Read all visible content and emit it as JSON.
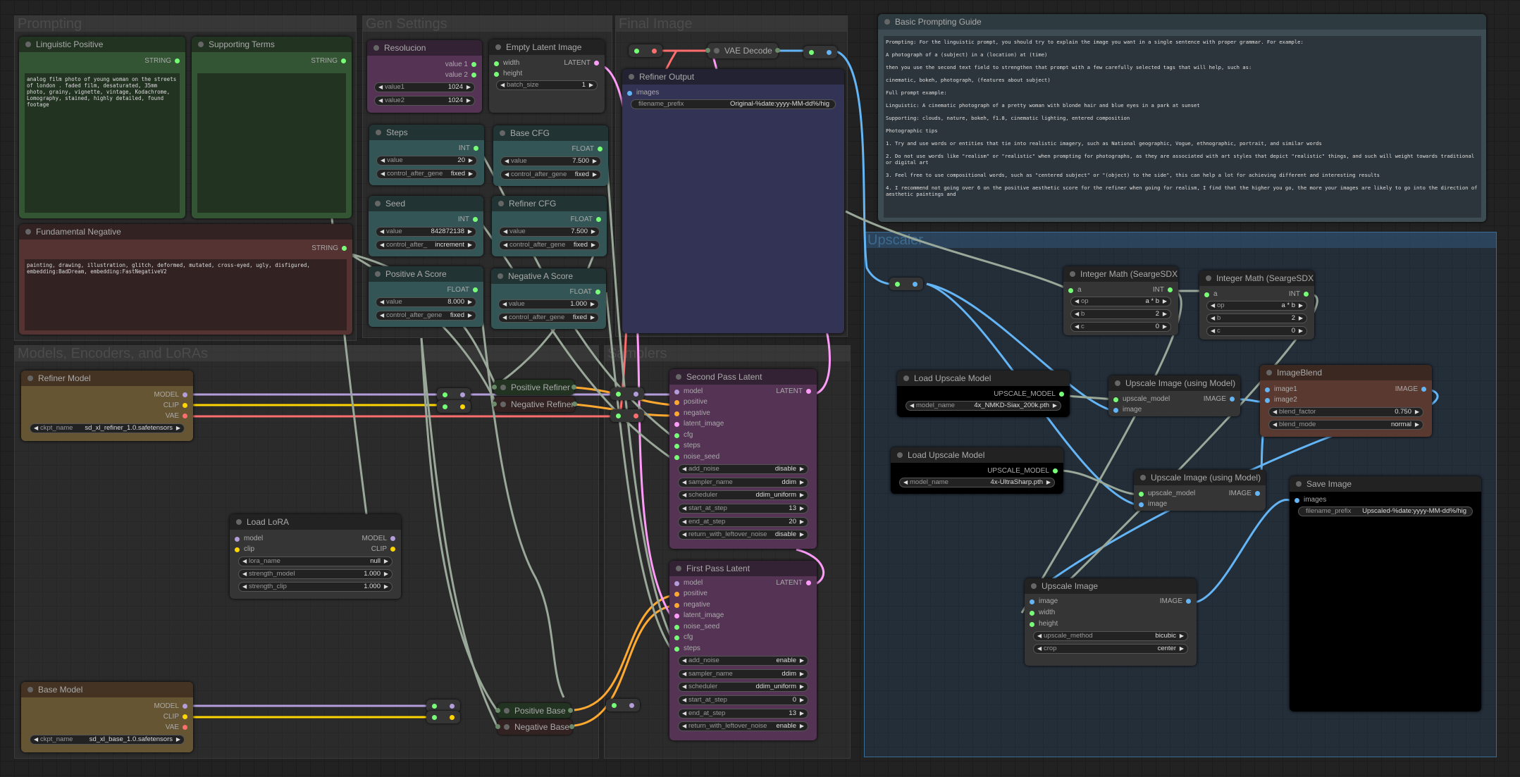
{
  "groups": {
    "prompting": "Prompting",
    "gen_settings": "Gen Settings",
    "final_image": "Final Image",
    "models": "Models, Encoders, and LoRAs",
    "samplers": "Samplers",
    "upscaler": "Upscaler"
  },
  "colors": {
    "model": "#b39ddb",
    "clip": "#ffd500",
    "vae": "#ff6e6e",
    "latent": "#ff9cf9",
    "image": "#64b5f6",
    "conditioning": "#ffa931",
    "number": "#7f7"
  },
  "linguistic_positive": {
    "title": "Linguistic Positive",
    "output": "STRING",
    "text": "analog film photo of young woman on the streets of london . faded film, desaturated, 35mm photo, grainy, vignette, vintage, Kodachrome, Lomography, stained, highly detailed, found footage"
  },
  "supporting_terms": {
    "title": "Supporting Terms",
    "output": "STRING",
    "text": ""
  },
  "fundamental_negative": {
    "title": "Fundamental Negative",
    "output": "STRING",
    "text": "painting, drawing, illustration, glitch, deformed, mutated, cross-eyed, ugly, disfigured,\nembedding:BadDream, embedding:FastNegativeV2"
  },
  "resolucion": {
    "title": "Resolucion",
    "out1": "value 1",
    "out2": "value 2",
    "w1_label": "value1",
    "w1_value": "1024",
    "w2_label": "value2",
    "w2_value": "1024"
  },
  "empty_latent": {
    "title": "Empty Latent Image",
    "in1": "width",
    "in2": "height",
    "output": "LATENT",
    "w_label": "batch_size",
    "w_value": "1"
  },
  "steps": {
    "title": "Steps",
    "output": "INT",
    "value_label": "value",
    "value": "20",
    "ctrl_label": "control_after_gene",
    "ctrl_value": "fixed"
  },
  "base_cfg": {
    "title": "Base CFG",
    "output": "FLOAT",
    "value_label": "value",
    "value": "7.500",
    "ctrl_label": "control_after_gene",
    "ctrl_value": "fixed"
  },
  "seed": {
    "title": "Seed",
    "output": "INT",
    "value_label": "value",
    "value": "842872138",
    "ctrl_label": "control_after_",
    "ctrl_value": "increment"
  },
  "refiner_cfg": {
    "title": "Refiner CFG",
    "output": "FLOAT",
    "value_label": "value",
    "value": "7.500",
    "ctrl_label": "control_after_gene",
    "ctrl_value": "fixed"
  },
  "pos_a_score": {
    "title": "Positive A Score",
    "output": "FLOAT",
    "value_label": "value",
    "value": "8.000",
    "ctrl_label": "control_after_gene",
    "ctrl_value": "fixed"
  },
  "neg_a_score": {
    "title": "Negative A Score",
    "output": "FLOAT",
    "value_label": "value",
    "value": "1.000",
    "ctrl_label": "control_after_gene",
    "ctrl_value": "fixed"
  },
  "vae_decode": {
    "title": "VAE Decode"
  },
  "refiner_output": {
    "title": "Refiner Output",
    "input": "images",
    "w_label": "filename_prefix",
    "w_value": "Original-%date:yyyy-MM-dd%/hig"
  },
  "guide": {
    "title": "Basic Prompting Guide",
    "text": "Prompting: For the linguistic prompt, you should try to explain the image you want in a single sentence with proper grammar. For example:\n\nA photograph of a (subject) in a (location) at (time)\n\nthen you use the second text field to strengthen that prompt with a few carefully selected tags that will help, such as:\n\ncinematic, bokeh, photograph, (features about subject)\n\nFull prompt example:\n\nLinguistic: A cinematic photograph of a pretty woman with blonde hair and blue eyes in a park at sunset\n\nSupporting: clouds, nature, bokeh, f1.8, cinematic lighting, entered composition\n\nPhotographic tips\n\n1. Try and use words or entities that tie into realistic imagery, such as National geographic, Vogue, ethnographic, portrait, and similar words\n\n2. Do not use words like \"realism\" or \"realistic\" when prompting for photographs, as they are associated with art styles that depict \"realistic\" things, and such will weight towards traditional or digital art\n\n3. Feel free to use compositional words, such as \"centered subject\" or \"(object) to the side\", this can help a lot for achieving different and interesting results\n\n4. I recommend not going over 6 on the positive aesthetic score for the refiner when going for realism, I find that the higher you go, the more your images are likely to go into the direction of aesthetic paintings and"
  },
  "refiner_model": {
    "title": "Refiner Model",
    "out1": "MODEL",
    "out2": "CLIP",
    "out3": "VAE",
    "w_label": "ckpt_name",
    "w_value": "sd_xl_refiner_1.0.safetensors"
  },
  "base_model": {
    "title": "Base Model",
    "out1": "MODEL",
    "out2": "CLIP",
    "out3": "VAE",
    "w_label": "ckpt_name",
    "w_value": "sd_xl_base_1.0.safetensors"
  },
  "load_lora": {
    "title": "Load LoRA",
    "in1": "model",
    "in2": "clip",
    "out1": "MODEL",
    "out2": "CLIP",
    "widgets": [
      {
        "label": "lora_name",
        "value": "null"
      },
      {
        "label": "strength_model",
        "value": "1.000"
      },
      {
        "label": "strength_clip",
        "value": "1.000"
      }
    ]
  },
  "positive_refiner": {
    "title": "Positive Refiner"
  },
  "negative_refiner": {
    "title": "Negative Refiner"
  },
  "positive_base": {
    "title": "Positive Base"
  },
  "negative_base": {
    "title": "Negative Base"
  },
  "second_pass": {
    "title": "Second Pass Latent",
    "output": "LATENT",
    "inputs": [
      "model",
      "positive",
      "negative",
      "latent_image",
      "cfg",
      "steps",
      "noise_seed"
    ],
    "widgets": [
      {
        "label": "add_noise",
        "value": "disable"
      },
      {
        "label": "sampler_name",
        "value": "ddim"
      },
      {
        "label": "scheduler",
        "value": "ddim_uniform"
      },
      {
        "label": "start_at_step",
        "value": "13"
      },
      {
        "label": "end_at_step",
        "value": "20"
      },
      {
        "label": "return_with_leftover_noise",
        "value": "disable"
      }
    ]
  },
  "first_pass": {
    "title": "First Pass Latent",
    "output": "LATENT",
    "inputs": [
      "model",
      "positive",
      "negative",
      "latent_image",
      "noise_seed",
      "cfg",
      "steps"
    ],
    "widgets": [
      {
        "label": "add_noise",
        "value": "enable"
      },
      {
        "label": "sampler_name",
        "value": "ddim"
      },
      {
        "label": "scheduler",
        "value": "ddim_uniform"
      },
      {
        "label": "start_at_step",
        "value": "0"
      },
      {
        "label": "end_at_step",
        "value": "13"
      },
      {
        "label": "return_with_leftover_noise",
        "value": "enable"
      }
    ]
  },
  "int_math_1": {
    "title": "Integer Math (SeargeSDXL)",
    "input": "a",
    "output": "INT",
    "widgets": [
      {
        "label": "op",
        "value": "a * b"
      },
      {
        "label": "b",
        "value": "2"
      },
      {
        "label": "c",
        "value": "0"
      }
    ]
  },
  "int_math_2": {
    "title": "Integer Math (SeargeSDXL)",
    "input": "a",
    "output": "INT",
    "widgets": [
      {
        "label": "op",
        "value": "a * b"
      },
      {
        "label": "b",
        "value": "2"
      },
      {
        "label": "c",
        "value": "0"
      }
    ]
  },
  "load_upscale_1": {
    "title": "Load Upscale Model",
    "output": "UPSCALE_MODEL",
    "w_label": "model_name",
    "w_value": "4x_NMKD-Siax_200k.pth"
  },
  "load_upscale_2": {
    "title": "Load Upscale Model",
    "output": "UPSCALE_MODEL",
    "w_label": "model_name",
    "w_value": "4x-UltraSharp.pth"
  },
  "upscale_model_1": {
    "title": "Upscale Image (using Model)",
    "in1": "upscale_model",
    "in2": "image",
    "output": "IMAGE"
  },
  "upscale_model_2": {
    "title": "Upscale Image (using Model)",
    "in1": "upscale_model",
    "in2": "image",
    "output": "IMAGE"
  },
  "image_blend": {
    "title": "ImageBlend",
    "in1": "image1",
    "in2": "image2",
    "output": "IMAGE",
    "widgets": [
      {
        "label": "blend_factor",
        "value": "0.750"
      },
      {
        "label": "blend_mode",
        "value": "normal"
      }
    ]
  },
  "upscale_image": {
    "title": "Upscale Image",
    "in1": "image",
    "in2": "width",
    "in3": "height",
    "output": "IMAGE",
    "widgets": [
      {
        "label": "upscale_method",
        "value": "bicubic"
      },
      {
        "label": "crop",
        "value": "center"
      }
    ]
  },
  "save_image": {
    "title": "Save Image",
    "input": "images",
    "w_label": "filename_prefix",
    "w_value": "Upscaled-%date:yyyy-MM-dd%/hig"
  }
}
